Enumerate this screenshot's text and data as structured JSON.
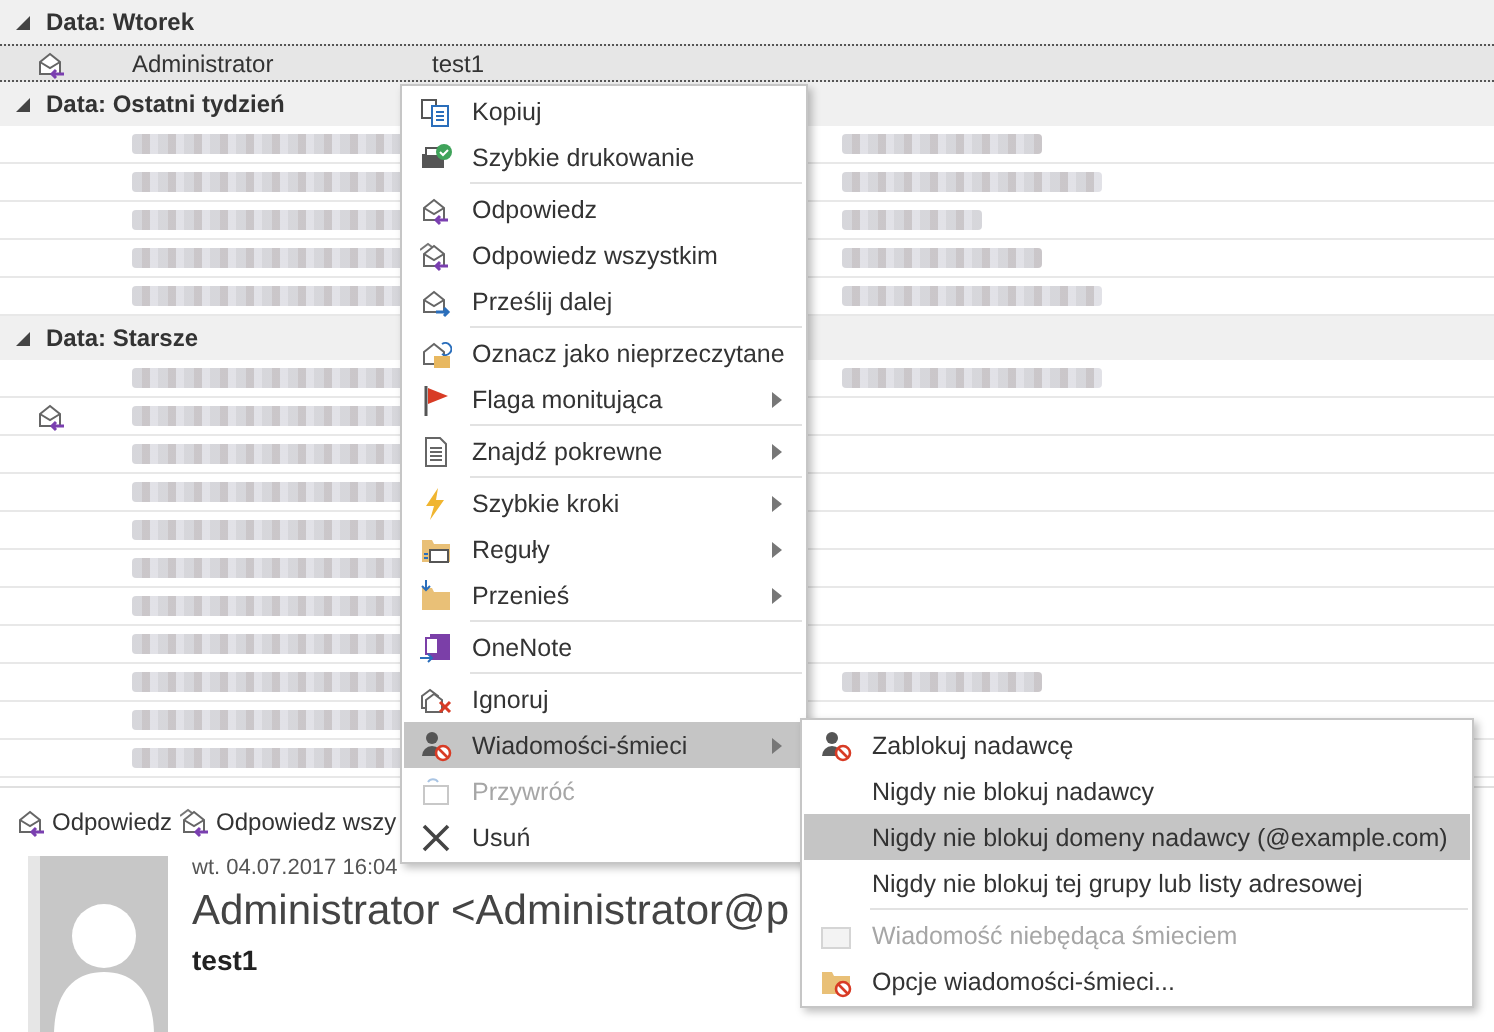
{
  "message_list": {
    "groups": [
      {
        "title": "Data: Wtorek",
        "expanded": true,
        "rows": [
          {
            "kind": "message",
            "replied": true,
            "sender": "Administrator",
            "subject": "test1",
            "selected": true
          }
        ]
      },
      {
        "title": "Data: Ostatni tydzień",
        "expanded": true,
        "rows": [
          {
            "kind": "blurred",
            "replied": false,
            "subject_visible": true
          },
          {
            "kind": "blurred",
            "replied": false,
            "subject_visible": true
          },
          {
            "kind": "blurred",
            "replied": false,
            "subject_visible": true
          },
          {
            "kind": "blurred",
            "replied": false,
            "subject_visible": true
          },
          {
            "kind": "blurred",
            "replied": false,
            "subject_visible": true
          }
        ]
      },
      {
        "title": "Data: Starsze",
        "expanded": true,
        "rows": [
          {
            "kind": "blurred",
            "replied": false,
            "subject_visible": true
          },
          {
            "kind": "blurred",
            "replied": true,
            "subject_visible": false
          },
          {
            "kind": "blurred",
            "replied": false,
            "subject_visible": false
          },
          {
            "kind": "blurred",
            "replied": false,
            "subject_visible": false
          },
          {
            "kind": "blurred",
            "replied": false,
            "subject_visible": false
          },
          {
            "kind": "blurred",
            "replied": false,
            "subject_visible": false
          },
          {
            "kind": "blurred",
            "replied": false,
            "subject_visible": false
          },
          {
            "kind": "blurred",
            "replied": false,
            "subject_visible": false
          },
          {
            "kind": "blurred",
            "replied": false,
            "subject_visible": true
          },
          {
            "kind": "blurred",
            "replied": false
          },
          {
            "kind": "blurred",
            "replied": false
          }
        ]
      }
    ]
  },
  "reading_pane": {
    "actions": [
      {
        "kind": "reply",
        "label": "Odpowiedz"
      },
      {
        "kind": "replyall",
        "label": "Odpowiedz wszy"
      }
    ],
    "date": "wt. 04.07.2017 16:04",
    "sender": "Administrator <Administrator@p",
    "subject": "test1"
  },
  "context_menu": {
    "items": [
      {
        "kind": "copy",
        "label": "Kopiuj",
        "submenu": false,
        "disabled": false,
        "selected": false
      },
      {
        "kind": "print",
        "label": "Szybkie drukowanie",
        "submenu": false,
        "disabled": false,
        "selected": false
      },
      {
        "kind": "separator"
      },
      {
        "kind": "reply",
        "label": "Odpowiedz",
        "submenu": false,
        "disabled": false,
        "selected": false
      },
      {
        "kind": "replyall",
        "label": "Odpowiedz wszystkim",
        "submenu": false,
        "disabled": false,
        "selected": false
      },
      {
        "kind": "forward",
        "label": "Prześlij dalej",
        "submenu": false,
        "disabled": false,
        "selected": false
      },
      {
        "kind": "separator"
      },
      {
        "kind": "unread",
        "label": "Oznacz jako nieprzeczytane",
        "submenu": false,
        "disabled": false,
        "selected": false
      },
      {
        "kind": "flag",
        "label": "Flaga monitująca",
        "submenu": true,
        "disabled": false,
        "selected": false
      },
      {
        "kind": "separator"
      },
      {
        "kind": "document",
        "label": "Znajdź pokrewne",
        "submenu": true,
        "disabled": false,
        "selected": false
      },
      {
        "kind": "separator"
      },
      {
        "kind": "bolt",
        "label": "Szybkie kroki",
        "submenu": true,
        "disabled": false,
        "selected": false
      },
      {
        "kind": "rules",
        "label": "Reguły",
        "submenu": true,
        "disabled": false,
        "selected": false
      },
      {
        "kind": "move",
        "label": "Przenieś",
        "submenu": true,
        "disabled": false,
        "selected": false
      },
      {
        "kind": "separator"
      },
      {
        "kind": "onenote",
        "label": "OneNote",
        "submenu": false,
        "disabled": false,
        "selected": false
      },
      {
        "kind": "separator"
      },
      {
        "kind": "ignore",
        "label": "Ignoruj",
        "submenu": false,
        "disabled": false,
        "selected": false
      },
      {
        "kind": "junk",
        "label": "Wiadomości-śmieci",
        "submenu": true,
        "disabled": false,
        "selected": true
      },
      {
        "kind": "restore",
        "label": "Przywróć",
        "submenu": false,
        "disabled": true,
        "selected": false
      },
      {
        "kind": "delete",
        "label": "Usuń",
        "submenu": false,
        "disabled": false,
        "selected": false
      }
    ]
  },
  "junk_submenu": {
    "items": [
      {
        "kind": "junk",
        "label": "Zablokuj nadawcę",
        "submenu": false,
        "disabled": false,
        "selected": false
      },
      {
        "kind": "plain",
        "label": "Nigdy nie blokuj nadawcy",
        "submenu": false,
        "disabled": false,
        "selected": false
      },
      {
        "kind": "plain",
        "label": "Nigdy nie blokuj domeny nadawcy (@example.com)",
        "submenu": false,
        "disabled": false,
        "selected": true
      },
      {
        "kind": "plain",
        "label": "Nigdy nie blokuj tej grupy lub listy adresowej",
        "submenu": false,
        "disabled": false,
        "selected": false
      },
      {
        "kind": "separator"
      },
      {
        "kind": "notjunk",
        "label": "Wiadomość niebędąca śmieciem",
        "submenu": false,
        "disabled": true,
        "selected": false
      },
      {
        "kind": "junkoptions",
        "label": "Opcje wiadomości-śmieci...",
        "submenu": false,
        "disabled": false,
        "selected": false
      }
    ]
  }
}
